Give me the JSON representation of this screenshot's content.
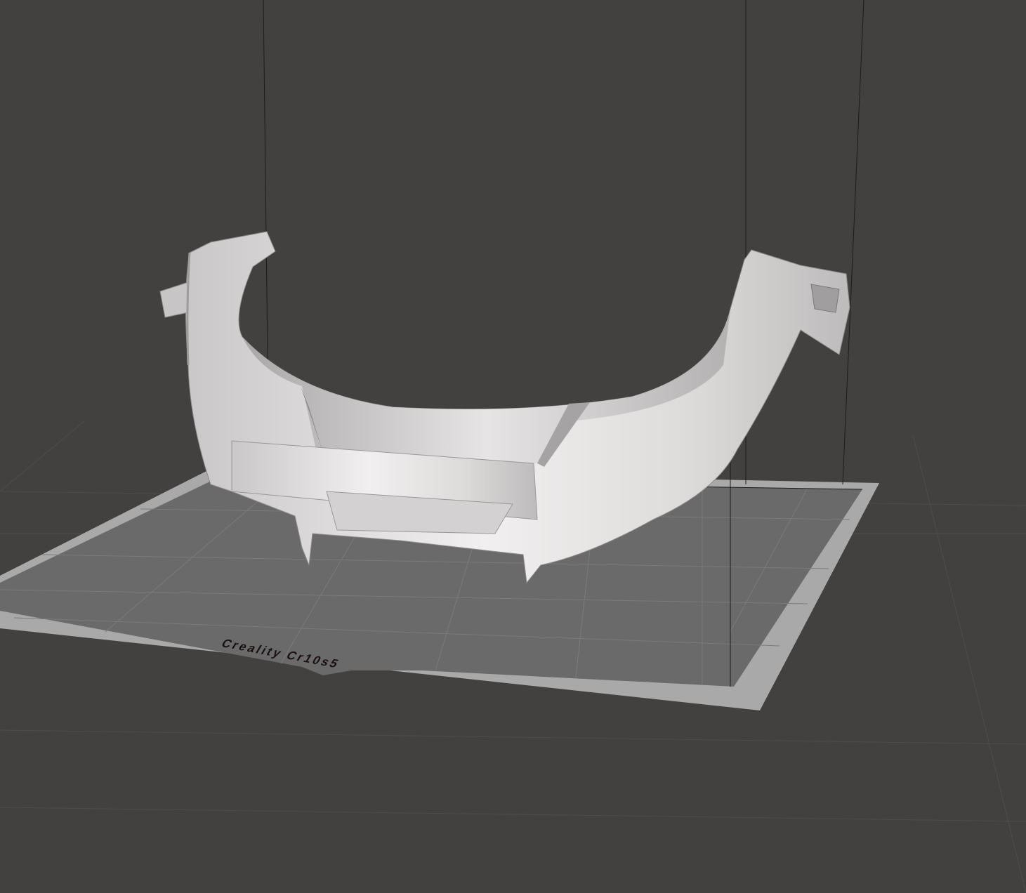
{
  "viewport": {
    "build_plate_label": "Creality Cr10s5",
    "colors": {
      "background": "#424140",
      "plate_frame": "#a9a9a9",
      "plate": "#6b6b6b",
      "model": "#d8d6d6"
    }
  }
}
